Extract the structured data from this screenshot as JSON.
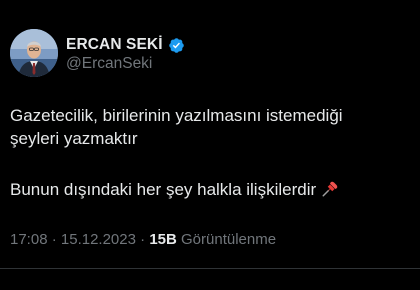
{
  "author": {
    "display_name": "ERCAN SEKİ",
    "handle": "@ErcanSeki",
    "verified": true,
    "avatar_icon": "profile-photo-avatar"
  },
  "tweet": {
    "paragraph1_line1": "Gazetecilik, birilerinin yazılmasını istemediği",
    "paragraph1_line2": "şeyleri yazmaktır",
    "paragraph2": "Bunun dışındaki her şey halkla ilişkilerdir",
    "emoji_icon": "pushpin-icon"
  },
  "meta": {
    "time": "17:08",
    "separator": "·",
    "date": "15.12.2023",
    "views_count": "15B",
    "views_label": "Görüntülenme"
  },
  "colors": {
    "background": "#000000",
    "primary_text": "#e7e9ea",
    "secondary_text": "#71767b",
    "verified_blue": "#1d9bf0",
    "pin_red": "#e53935"
  }
}
